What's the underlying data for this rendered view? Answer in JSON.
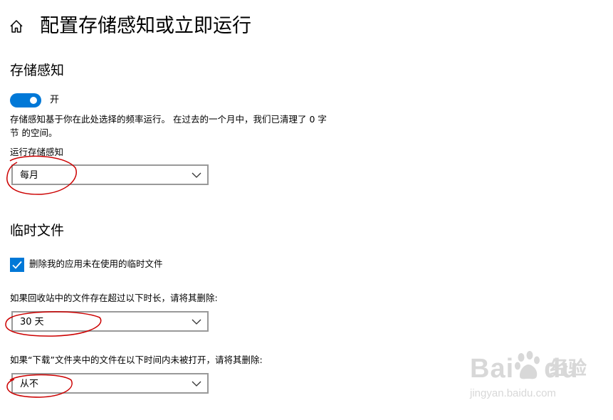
{
  "header": {
    "title": "配置存储感知或立即运行",
    "home_icon": "home-icon"
  },
  "storage_sense": {
    "heading": "存储感知",
    "toggle": {
      "state": "on",
      "label": "开"
    },
    "description": "存储感知基于你在此处选择的频率运行。 在过去的一个月中，我们已清理了 0 字节 的空间。",
    "run_label": "运行存储感知",
    "run_value": "每月"
  },
  "temp_files": {
    "heading": "临时文件",
    "delete_temp": {
      "checked": true,
      "label": "删除我的应用未在使用的临时文件"
    },
    "recycle_label": "如果回收站中的文件存在超过以下时长，请将其删除:",
    "recycle_value": "30 天",
    "downloads_label": "如果“下载”文件夹中的文件在以下时间内未被打开，请将其删除:",
    "downloads_value": "从不"
  },
  "watermark": {
    "brand": "Bai",
    "brand_suffix": "du",
    "cn": "经验",
    "url": "jingyan.baidu.com"
  },
  "colors": {
    "accent": "#0078d7",
    "annotation": "#cc0000",
    "dropdown_border": "#999999",
    "watermark": "#d8d8d8"
  }
}
